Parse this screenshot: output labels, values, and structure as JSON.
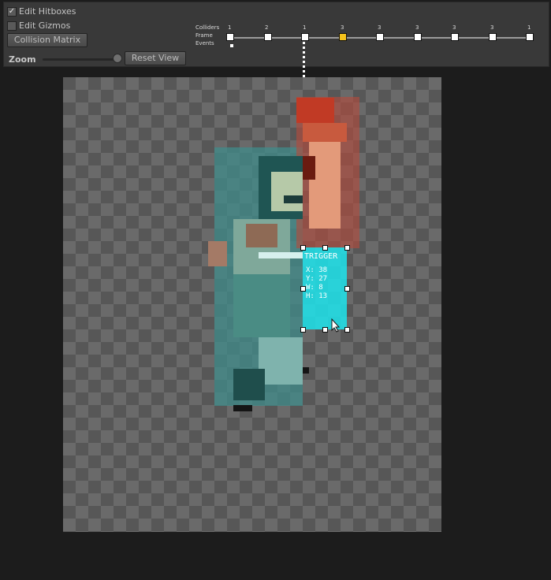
{
  "toolbar": {
    "edit_hitboxes": {
      "label": "Edit Hitboxes",
      "checked": true
    },
    "edit_gizmos": {
      "label": "Edit Gizmos",
      "checked": false
    },
    "collision_matrix_label": "Collision Matrix",
    "zoom_label": "Zoom",
    "zoom_level": 0.88,
    "reset_view_label": "Reset View"
  },
  "timeline": {
    "row_colliders": "Colliders",
    "row_frame": "Frame",
    "row_events": "Events",
    "collider_counts": [
      "1",
      "2",
      "1",
      "3",
      "3",
      "3",
      "3",
      "3",
      "1"
    ],
    "selected_frame_index": 3,
    "colors": {
      "key": "#ffffff",
      "selected_key": "#f5c21b"
    }
  },
  "editor": {
    "trigger": {
      "label": "TRIGGER",
      "x": "X: 38",
      "y": "Y: 27",
      "w": "W: 8",
      "h": "H: 13"
    },
    "colors": {
      "trigger": "#20e0e8",
      "hurtbox": "#3f8e8c",
      "hitbox": "#b44a3c"
    },
    "cursor_icon": "arrow-cursor"
  }
}
